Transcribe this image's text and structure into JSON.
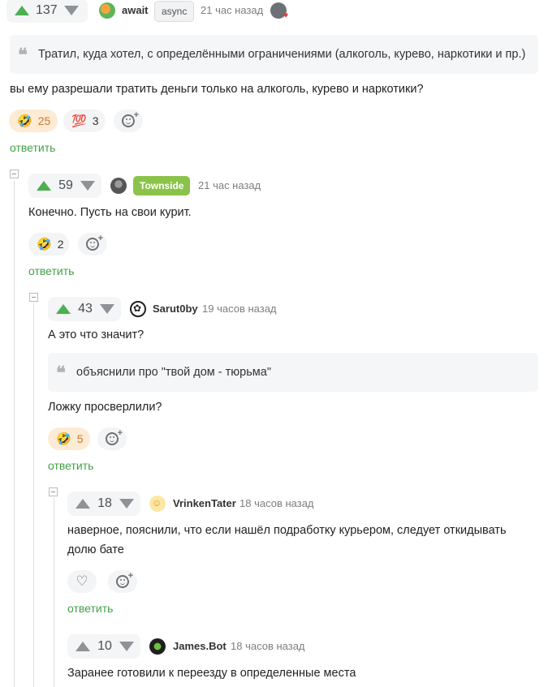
{
  "comments": [
    {
      "rating": "137",
      "nick": "await",
      "badge": "async",
      "time": "21 час назад",
      "quote": "Тратил, куда хотел, с определёнными ограничениями (алкоголь, курево, наркотики и пр.)",
      "text": "вы ему разрешали тратить деньги только на алкоголь, курево и наркотики?",
      "reactions": [
        {
          "emoji": "🤣",
          "count": "25"
        },
        {
          "emoji": "💯",
          "count": "3"
        }
      ],
      "reply": "ответить"
    },
    {
      "rating": "59",
      "nick": "Townside",
      "time": "21 час назад",
      "text": "Конечно. Пусть на свои курит.",
      "reactions": [
        {
          "emoji": "🤣",
          "count": "2"
        }
      ],
      "reply": "ответить"
    },
    {
      "rating": "43",
      "nick": "Sarut0by",
      "time": "19 часов назад",
      "text": "А это что значит?",
      "quote": "объяснили про \"твой дом - тюрьма\"",
      "text2": "Ложку просверлили?",
      "reactions": [
        {
          "emoji": "🤣",
          "count": "5"
        }
      ],
      "reply": "ответить"
    },
    {
      "rating": "18",
      "nick": "VrinkenTater",
      "time": "18 часов назад",
      "text_line1": "наверное, пояснили, что если нашёл подработку курьером, следует откидывать",
      "text_line2": "долю бате",
      "reply": "ответить"
    },
    {
      "rating": "10",
      "nick": "James.Bot",
      "time": "18 часов назад",
      "text": "Заранее готовили к переезду в определенные места"
    }
  ],
  "colors": {
    "accent_green": "#4caf50",
    "reply_green": "#43a047",
    "badge_green": "#8bc34a",
    "reaction_bg": "#fdebd5"
  },
  "icons": [
    "arrow-up-icon",
    "arrow-down-icon",
    "quote-icon",
    "add-reaction-icon",
    "heart-icon",
    "collapse-icon"
  ]
}
